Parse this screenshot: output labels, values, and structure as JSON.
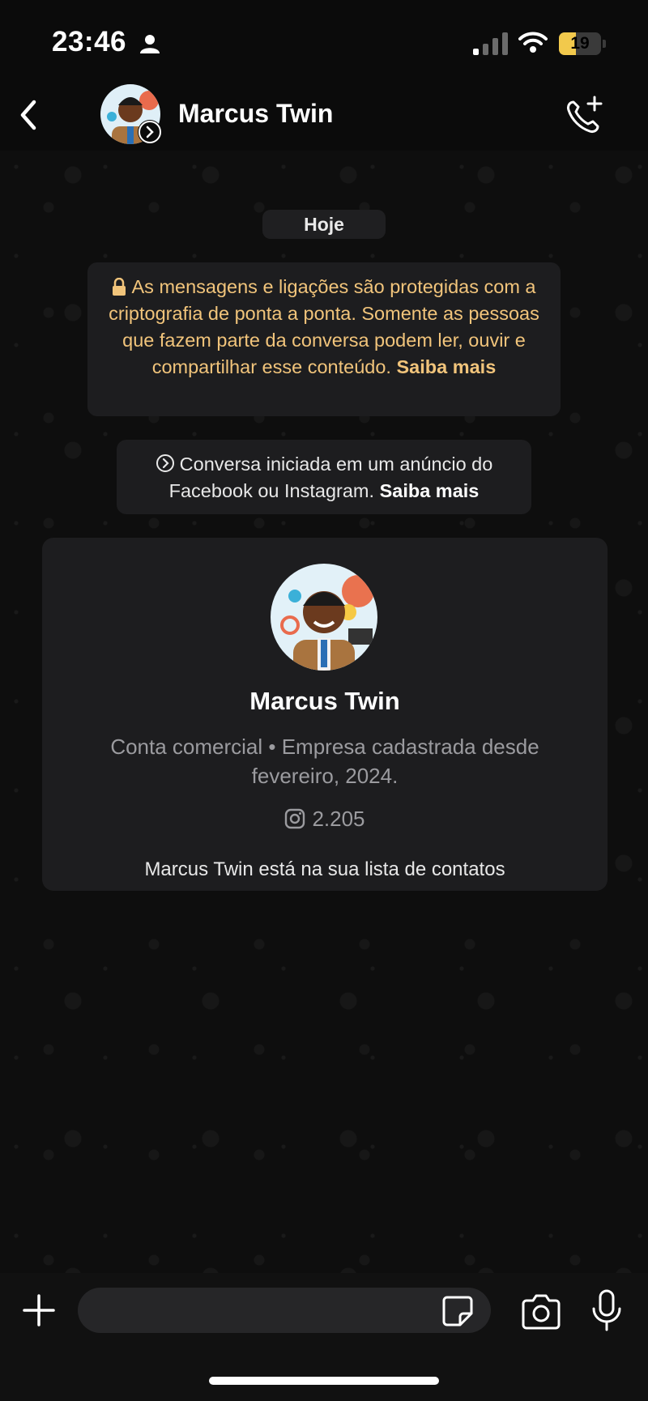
{
  "status_bar": {
    "time": "23:46",
    "battery": "19"
  },
  "header": {
    "contact_name": "Marcus Twin",
    "avatar_icon": "cartoon-avatar",
    "call_icon": "add-call-icon"
  },
  "chat": {
    "date_chip": "Hoje",
    "e2e_notice": {
      "text": "As mensagens e ligações são protegidas com a criptografia de ponta a ponta. Somente as pessoas que fazem parte da conversa podem ler, ouvir e compartilhar esse conteúdo.",
      "link": "Saiba mais"
    },
    "ad_notice": {
      "text": "Conversa iniciada em um anúncio do Facebook ou Instagram.",
      "link": "Saiba mais"
    },
    "profile_card": {
      "name": "Marcus Twin",
      "description": "Conta comercial • Empresa cadastrada desde fevereiro, 2024.",
      "followers": "2.205",
      "contacts_note": "Marcus Twin está na sua lista de contatos"
    }
  },
  "input_bar": {
    "placeholder": ""
  },
  "colors": {
    "accent_notice": "#f1c47b",
    "card_bg": "#1d1d1f",
    "background": "#0b0b0b"
  }
}
